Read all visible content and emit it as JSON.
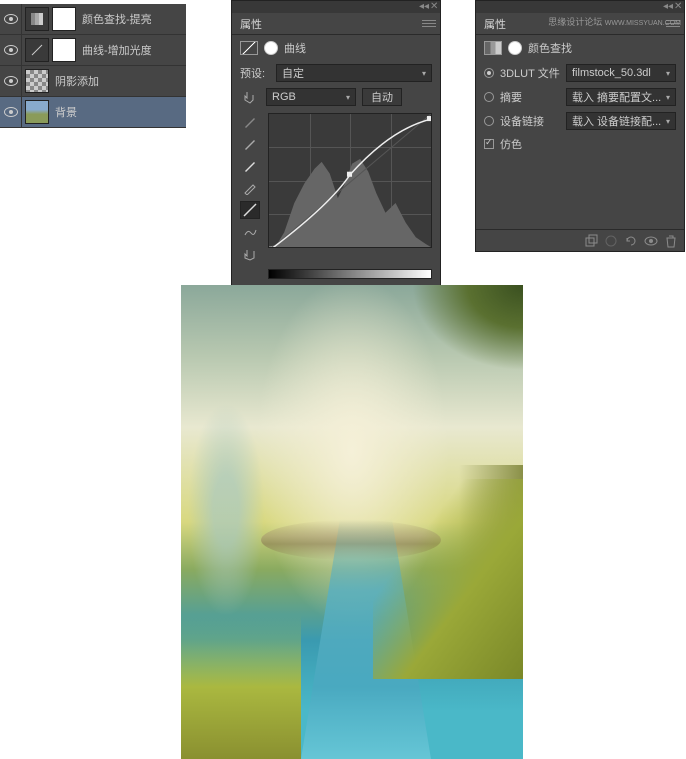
{
  "layers": [
    {
      "name": "颜色查找-提亮",
      "adj": "lut",
      "mask": true
    },
    {
      "name": "曲线-增加光度",
      "adj": "curves",
      "mask": true
    },
    {
      "name": "阴影添加",
      "checker": true
    },
    {
      "name": "背景",
      "img": true,
      "selected": true
    }
  ],
  "curves_panel": {
    "tab": "属性",
    "type_label": "曲线",
    "preset_label": "预设:",
    "preset_value": "自定",
    "channel": "RGB",
    "auto_btn": "自动"
  },
  "lut_panel": {
    "tab": "属性",
    "watermark_title": "思缘设计论坛",
    "watermark_url": "WWW.MISSYUAN.COM",
    "type_label": "颜色查找",
    "row1_label": "3DLUT 文件",
    "row1_value": "filmstock_50.3dl",
    "row2_label": "摘要",
    "row2_value": "载入 摘要配置文...",
    "row3_label": "设备链接",
    "row3_value": "载入 设备链接配...",
    "dither_label": "仿色"
  }
}
